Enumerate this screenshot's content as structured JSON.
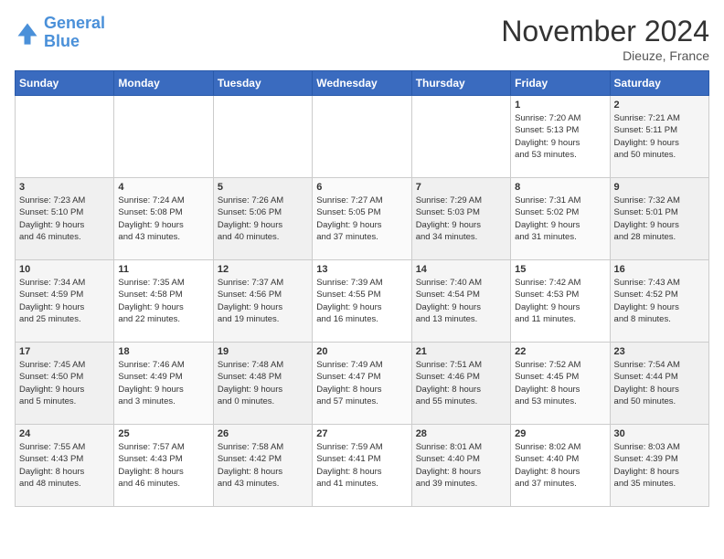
{
  "logo": {
    "text_general": "General",
    "text_blue": "Blue"
  },
  "title": "November 2024",
  "location": "Dieuze, France",
  "days_of_week": [
    "Sunday",
    "Monday",
    "Tuesday",
    "Wednesday",
    "Thursday",
    "Friday",
    "Saturday"
  ],
  "weeks": [
    [
      {
        "day": "",
        "info": ""
      },
      {
        "day": "",
        "info": ""
      },
      {
        "day": "",
        "info": ""
      },
      {
        "day": "",
        "info": ""
      },
      {
        "day": "",
        "info": ""
      },
      {
        "day": "1",
        "info": "Sunrise: 7:20 AM\nSunset: 5:13 PM\nDaylight: 9 hours\nand 53 minutes."
      },
      {
        "day": "2",
        "info": "Sunrise: 7:21 AM\nSunset: 5:11 PM\nDaylight: 9 hours\nand 50 minutes."
      }
    ],
    [
      {
        "day": "3",
        "info": "Sunrise: 7:23 AM\nSunset: 5:10 PM\nDaylight: 9 hours\nand 46 minutes."
      },
      {
        "day": "4",
        "info": "Sunrise: 7:24 AM\nSunset: 5:08 PM\nDaylight: 9 hours\nand 43 minutes."
      },
      {
        "day": "5",
        "info": "Sunrise: 7:26 AM\nSunset: 5:06 PM\nDaylight: 9 hours\nand 40 minutes."
      },
      {
        "day": "6",
        "info": "Sunrise: 7:27 AM\nSunset: 5:05 PM\nDaylight: 9 hours\nand 37 minutes."
      },
      {
        "day": "7",
        "info": "Sunrise: 7:29 AM\nSunset: 5:03 PM\nDaylight: 9 hours\nand 34 minutes."
      },
      {
        "day": "8",
        "info": "Sunrise: 7:31 AM\nSunset: 5:02 PM\nDaylight: 9 hours\nand 31 minutes."
      },
      {
        "day": "9",
        "info": "Sunrise: 7:32 AM\nSunset: 5:01 PM\nDaylight: 9 hours\nand 28 minutes."
      }
    ],
    [
      {
        "day": "10",
        "info": "Sunrise: 7:34 AM\nSunset: 4:59 PM\nDaylight: 9 hours\nand 25 minutes."
      },
      {
        "day": "11",
        "info": "Sunrise: 7:35 AM\nSunset: 4:58 PM\nDaylight: 9 hours\nand 22 minutes."
      },
      {
        "day": "12",
        "info": "Sunrise: 7:37 AM\nSunset: 4:56 PM\nDaylight: 9 hours\nand 19 minutes."
      },
      {
        "day": "13",
        "info": "Sunrise: 7:39 AM\nSunset: 4:55 PM\nDaylight: 9 hours\nand 16 minutes."
      },
      {
        "day": "14",
        "info": "Sunrise: 7:40 AM\nSunset: 4:54 PM\nDaylight: 9 hours\nand 13 minutes."
      },
      {
        "day": "15",
        "info": "Sunrise: 7:42 AM\nSunset: 4:53 PM\nDaylight: 9 hours\nand 11 minutes."
      },
      {
        "day": "16",
        "info": "Sunrise: 7:43 AM\nSunset: 4:52 PM\nDaylight: 9 hours\nand 8 minutes."
      }
    ],
    [
      {
        "day": "17",
        "info": "Sunrise: 7:45 AM\nSunset: 4:50 PM\nDaylight: 9 hours\nand 5 minutes."
      },
      {
        "day": "18",
        "info": "Sunrise: 7:46 AM\nSunset: 4:49 PM\nDaylight: 9 hours\nand 3 minutes."
      },
      {
        "day": "19",
        "info": "Sunrise: 7:48 AM\nSunset: 4:48 PM\nDaylight: 9 hours\nand 0 minutes."
      },
      {
        "day": "20",
        "info": "Sunrise: 7:49 AM\nSunset: 4:47 PM\nDaylight: 8 hours\nand 57 minutes."
      },
      {
        "day": "21",
        "info": "Sunrise: 7:51 AM\nSunset: 4:46 PM\nDaylight: 8 hours\nand 55 minutes."
      },
      {
        "day": "22",
        "info": "Sunrise: 7:52 AM\nSunset: 4:45 PM\nDaylight: 8 hours\nand 53 minutes."
      },
      {
        "day": "23",
        "info": "Sunrise: 7:54 AM\nSunset: 4:44 PM\nDaylight: 8 hours\nand 50 minutes."
      }
    ],
    [
      {
        "day": "24",
        "info": "Sunrise: 7:55 AM\nSunset: 4:43 PM\nDaylight: 8 hours\nand 48 minutes."
      },
      {
        "day": "25",
        "info": "Sunrise: 7:57 AM\nSunset: 4:43 PM\nDaylight: 8 hours\nand 46 minutes."
      },
      {
        "day": "26",
        "info": "Sunrise: 7:58 AM\nSunset: 4:42 PM\nDaylight: 8 hours\nand 43 minutes."
      },
      {
        "day": "27",
        "info": "Sunrise: 7:59 AM\nSunset: 4:41 PM\nDaylight: 8 hours\nand 41 minutes."
      },
      {
        "day": "28",
        "info": "Sunrise: 8:01 AM\nSunset: 4:40 PM\nDaylight: 8 hours\nand 39 minutes."
      },
      {
        "day": "29",
        "info": "Sunrise: 8:02 AM\nSunset: 4:40 PM\nDaylight: 8 hours\nand 37 minutes."
      },
      {
        "day": "30",
        "info": "Sunrise: 8:03 AM\nSunset: 4:39 PM\nDaylight: 8 hours\nand 35 minutes."
      }
    ]
  ]
}
